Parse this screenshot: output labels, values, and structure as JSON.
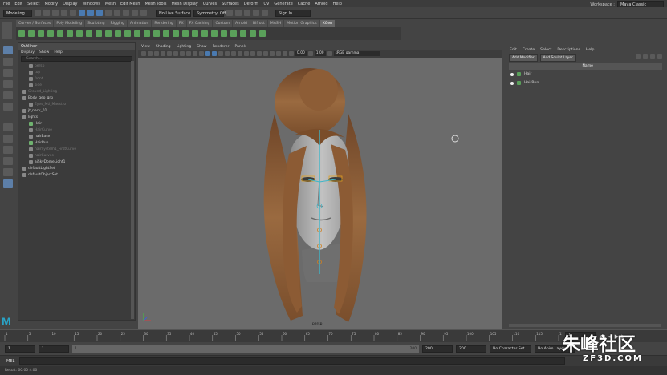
{
  "menubar": {
    "items": [
      "File",
      "Edit",
      "Select",
      "Modify",
      "Display",
      "Windows",
      "Mesh",
      "Edit Mesh",
      "Mesh Tools",
      "Mesh Display",
      "Curves",
      "Surfaces",
      "Deform",
      "UV",
      "Generate",
      "Cache",
      "Arnold",
      "Help"
    ],
    "workspace_label": "Workspace :",
    "workspace_value": "Maya Classic"
  },
  "statusline": {
    "mode": "Modeling",
    "live_surface": "No Live Surface",
    "symmetry": "Symmetry: Off",
    "sign_in": "Sign In"
  },
  "shelf_tabs": [
    "Curves / Surfaces",
    "Poly Modeling",
    "Sculpting",
    "Rigging",
    "Animation",
    "Rendering",
    "FX",
    "FX Caching",
    "Custom",
    "Arnold",
    "Bifrost",
    "MASH",
    "Motion Graphics",
    "XGen"
  ],
  "shelf_active": "XGen",
  "outliner": {
    "title": "Outliner",
    "menu": [
      "Display",
      "Show",
      "Help"
    ],
    "search_placeholder": "Search...",
    "items": [
      {
        "label": "persp",
        "dim": true,
        "indent": 1
      },
      {
        "label": "top",
        "dim": true,
        "indent": 1
      },
      {
        "label": "front",
        "dim": true,
        "indent": 1
      },
      {
        "label": "side",
        "dim": true,
        "indent": 1
      },
      {
        "label": "Ground_Lighting",
        "dim": true,
        "indent": 0
      },
      {
        "label": "Body_geo_grp",
        "dim": false,
        "indent": 0
      },
      {
        "label": "Eyes_Mtl_Maestro",
        "dim": true,
        "indent": 1
      },
      {
        "label": "jt_neck_01",
        "dim": false,
        "indent": 0
      },
      {
        "label": "lights",
        "dim": false,
        "indent": 0
      },
      {
        "label": "Hair",
        "dim": false,
        "indent": 1,
        "green": true
      },
      {
        "label": "HairCurve",
        "dim": true,
        "indent": 1
      },
      {
        "label": "hairBase",
        "dim": false,
        "indent": 1
      },
      {
        "label": "HairRun",
        "dim": false,
        "indent": 1,
        "green": true
      },
      {
        "label": "hairSystem1_FirstCurve",
        "dim": true,
        "indent": 1
      },
      {
        "label": "hairCurves",
        "dim": true,
        "indent": 1
      },
      {
        "label": "aiSkyDomeLight1",
        "dim": false,
        "indent": 1
      },
      {
        "label": "defaultLightSet",
        "dim": false,
        "indent": 0
      },
      {
        "label": "defaultObjectSet",
        "dim": false,
        "indent": 0
      }
    ]
  },
  "viewport": {
    "menu": [
      "View",
      "Shading",
      "Lighting",
      "Show",
      "Renderer",
      "Panels"
    ],
    "exposure": "0.00",
    "gamma": "1.00",
    "color_space": "sRGB gamma",
    "camera": "persp"
  },
  "xgen_panel": {
    "menu": [
      "Edit",
      "Create",
      "Select",
      "Descriptions",
      "Help"
    ],
    "add_modifier": "Add Modifier",
    "add_sculpt_layer": "Add Sculpt Layer",
    "column_name": "Name",
    "rows": [
      "Hair",
      "HairRun"
    ]
  },
  "timeline": {
    "ticks": [
      "1",
      "5",
      "10",
      "15",
      "20",
      "25",
      "30",
      "35",
      "40",
      "45",
      "50",
      "55",
      "60",
      "65",
      "70",
      "75",
      "80",
      "85",
      "90",
      "95",
      "100",
      "105",
      "110",
      "115",
      "120"
    ],
    "current_frame": "1"
  },
  "range": {
    "start": "1",
    "inner_start": "1",
    "slider_start": "1",
    "slider_end": "200",
    "inner_end": "200",
    "end": "200",
    "character_set": "No Character Set",
    "anim_layer": "No Anim Layer"
  },
  "cmdline": {
    "lang": "MEL"
  },
  "helpline": {
    "text": "Result: 00:00   4.00"
  },
  "branding": {
    "maya_letter": "M",
    "watermark_main": "朱峰社区",
    "watermark_sub": "ZF3D.COM"
  },
  "colors": {
    "viewport_bg": "#6b6b6b",
    "maya_teal": "#29a3c6",
    "hair_brown": "#8a5a34"
  }
}
